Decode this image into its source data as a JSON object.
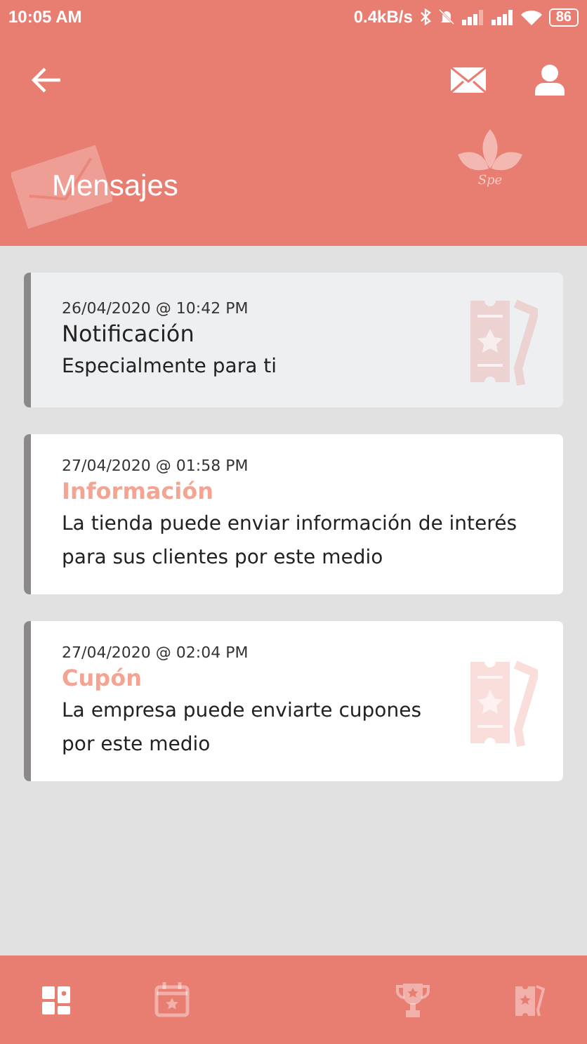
{
  "status_bar": {
    "time": "10:05 AM",
    "speed": "0.4kB/s",
    "battery": "86"
  },
  "header": {
    "title": "Mensajes",
    "logo_text": "Spe"
  },
  "messages": [
    {
      "date": "26/04/2020 @ 10:42 PM",
      "title": "Notificación",
      "body": "Especialmente para ti",
      "read": true,
      "kind": "coupon"
    },
    {
      "date": "27/04/2020 @ 01:58 PM",
      "title": "Información",
      "body": "La tienda puede enviar información de interés para sus clientes por este medio",
      "read": false,
      "kind": "info"
    },
    {
      "date": "27/04/2020 @ 02:04 PM",
      "title": "Cupón",
      "body": "La empresa puede enviarte cupones por este medio",
      "read": false,
      "kind": "coupon"
    }
  ],
  "bottom_nav": [
    {
      "kind": "dashboard",
      "selected": true
    },
    {
      "kind": "calendar",
      "selected": false
    },
    {
      "kind": "trophy",
      "selected": false
    },
    {
      "kind": "coupons",
      "selected": false
    }
  ]
}
